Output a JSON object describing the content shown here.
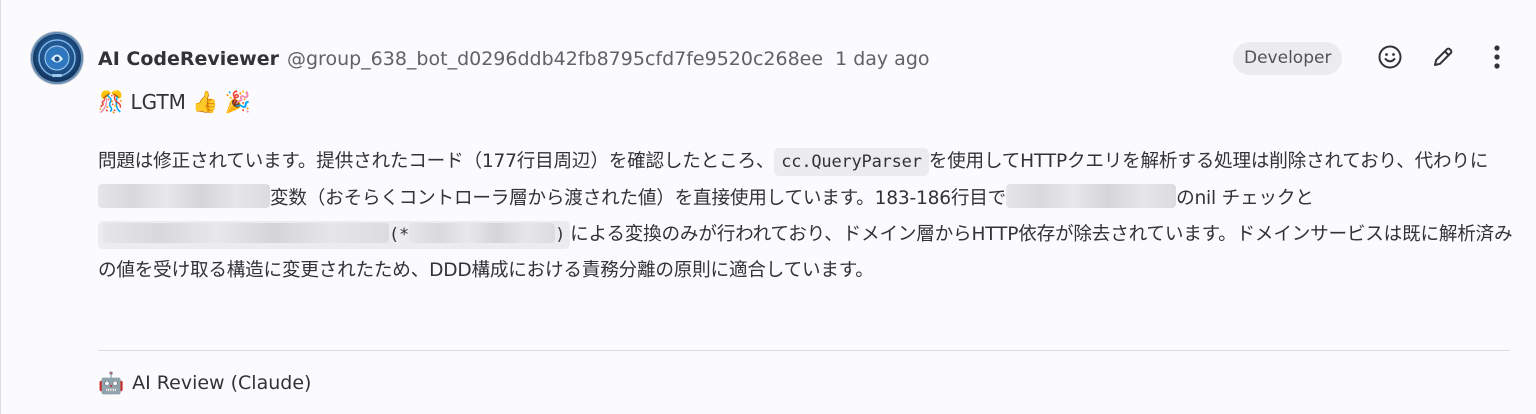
{
  "author": {
    "name": "AI CodeReviewer",
    "handle": "@group_638_bot_d0296ddb42fb8795cfd7fe9520c268ee",
    "timestamp": "1 day ago",
    "role_badge": "Developer"
  },
  "actions": {
    "icons": [
      "emoji-reaction-icon",
      "edit-pencil-icon",
      "more-actions-icon"
    ]
  },
  "comment": {
    "summary_prefix_emoji": "🎊",
    "summary_text": "LGTM",
    "summary_mid_emoji": "👍",
    "summary_suffix_emoji": "🎉",
    "p1": "問題は修正されています。提供されたコード（177行目周辺）を確認したところ、",
    "code1": "cc.QueryParser",
    "p2": "を使用してHTTPクエリを解析する処理は削除されており、代わりに",
    "p3": "変数（おそらくコントローラ層から渡された値）を直接使用しています。183-186行目で",
    "p4": "のnil チェックと",
    "code_open": "(*",
    "code_close": ")",
    "p5": "による変換のみが行われており、ドメイン層からHTTP依存が除去されています。ドメインサービスは既に解析済みの値を受け取る構造に変更されたため、DDD構成における責務分離の原則に適合しています。"
  },
  "footer": {
    "emoji": "🤖",
    "label": "AI Review (Claude)"
  },
  "colors": {
    "background": "#fbfafd",
    "text": "#333238",
    "muted": "#626168",
    "badge_bg": "#ececef"
  }
}
